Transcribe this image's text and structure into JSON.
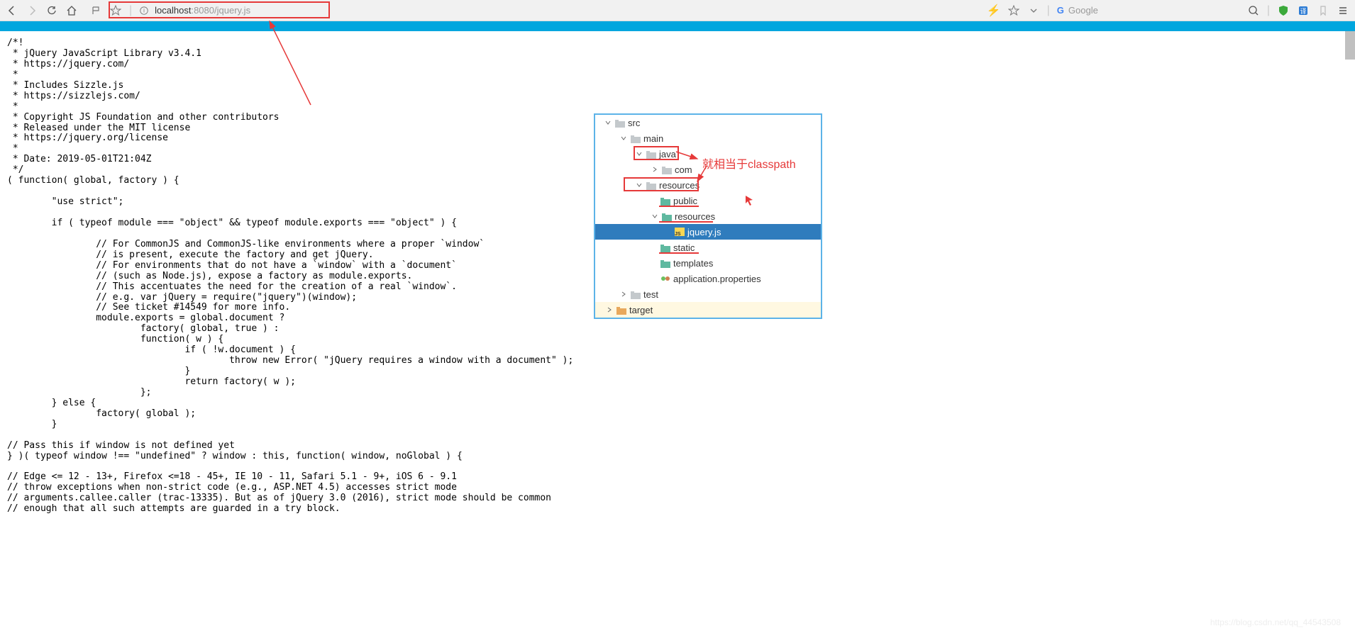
{
  "url": {
    "protocol_icon": "ⓘ",
    "host": "localhost",
    "port": ":8080",
    "path": "/jquery.js"
  },
  "search": {
    "engine": "Google"
  },
  "code": "/*!\n * jQuery JavaScript Library v3.4.1\n * https://jquery.com/\n *\n * Includes Sizzle.js\n * https://sizzlejs.com/\n *\n * Copyright JS Foundation and other contributors\n * Released under the MIT license\n * https://jquery.org/license\n *\n * Date: 2019-05-01T21:04Z\n */\n( function( global, factory ) {\n\n        \"use strict\";\n\n        if ( typeof module === \"object\" && typeof module.exports === \"object\" ) {\n\n                // For CommonJS and CommonJS-like environments where a proper `window`\n                // is present, execute the factory and get jQuery.\n                // For environments that do not have a `window` with a `document`\n                // (such as Node.js), expose a factory as module.exports.\n                // This accentuates the need for the creation of a real `window`.\n                // e.g. var jQuery = require(\"jquery\")(window);\n                // See ticket #14549 for more info.\n                module.exports = global.document ?\n                        factory( global, true ) :\n                        function( w ) {\n                                if ( !w.document ) {\n                                        throw new Error( \"jQuery requires a window with a document\" );\n                                }\n                                return factory( w );\n                        };\n        } else {\n                factory( global );\n        }\n\n// Pass this if window is not defined yet\n} )( typeof window !== \"undefined\" ? window : this, function( window, noGlobal ) {\n\n// Edge <= 12 - 13+, Firefox <=18 - 45+, IE 10 - 11, Safari 5.1 - 9+, iOS 6 - 9.1\n// throw exceptions when non-strict code (e.g., ASP.NET 4.5) accesses strict mode\n// arguments.callee.caller (trac-13335). But as of jQuery 3.0 (2016), strict mode should be common\n// enough that all such attempts are guarded in a try block.",
  "tree": {
    "src": "src",
    "main": "main",
    "java": "java",
    "com": "com",
    "resources": "resources",
    "public": "public",
    "resources2": "resources",
    "jqueryjs": "jquery.js",
    "static": "static",
    "templates": "templates",
    "appprops": "application.properties",
    "test": "test",
    "target": "target"
  },
  "annotation": "就相当于classpath",
  "watermark": "https://blog.csdn.net/qq_44543508"
}
